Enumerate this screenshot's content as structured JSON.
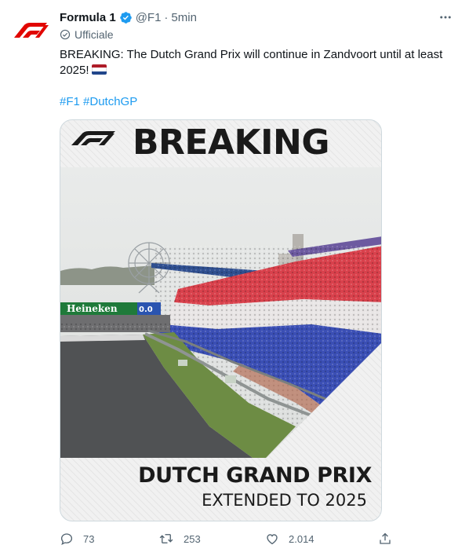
{
  "author": {
    "name": "Formula 1",
    "handle": "@F1",
    "separator": "·",
    "time": "5min",
    "badge_label": "Ufficiale",
    "verified_color": "#1d9bf0",
    "avatar_icon": "f1-logo-icon"
  },
  "tweet": {
    "text": "BREAKING: The Dutch Grand Prix will continue in Zandvoort until at least 2025!",
    "flag_icon": "netherlands-flag-icon",
    "hashtags": [
      "#F1",
      "#DutchGP"
    ]
  },
  "media": {
    "headline": "BREAKING",
    "title": "DUTCH GRAND PRIX",
    "subtitle": "EXTENDED TO 2025",
    "signage": "Heineken",
    "signage_suffix": "0.0"
  },
  "actions": {
    "replies": "73",
    "retweets": "253",
    "likes": "2.014"
  },
  "colors": {
    "brand_red": "#e10600",
    "link": "#1d9bf0",
    "muted": "#536471"
  }
}
